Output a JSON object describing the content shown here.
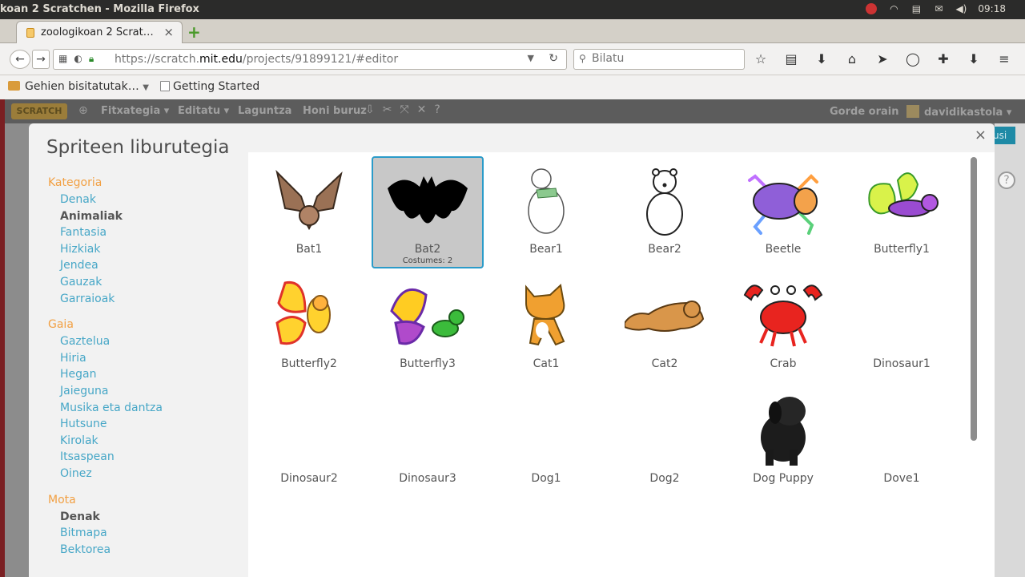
{
  "os": {
    "window_title": "koan 2 Scratchen - Mozilla Firefox",
    "clock": "09:18"
  },
  "browser": {
    "tab_title": "zoologikoan 2 Scrat…",
    "tab_close": "×",
    "new_tab": "+",
    "url_scheme": "https://scratch.",
    "url_host": "mit.edu",
    "url_path": "/projects/91899121/#editor",
    "search_placeholder": "Bilatu",
    "bookmarks": [
      "Gehien bisitatutak…",
      "Getting Started"
    ]
  },
  "scratch": {
    "logo": "SCRATCH",
    "menu": [
      "Fitxategia ▾",
      "Editatu ▾",
      "Laguntza",
      "Honi buruz"
    ],
    "save": "Gorde orain",
    "user": "davidikastola ▾",
    "right_button": "usi"
  },
  "library": {
    "title": "Spriteen liburutegia",
    "close": "×",
    "sections": [
      {
        "heading": "Kategoria",
        "items": [
          {
            "label": "Denak",
            "selected": false
          },
          {
            "label": "Animaliak",
            "selected": true
          },
          {
            "label": "Fantasia",
            "selected": false
          },
          {
            "label": "Hizkiak",
            "selected": false
          },
          {
            "label": "Jendea",
            "selected": false
          },
          {
            "label": "Gauzak",
            "selected": false
          },
          {
            "label": "Garraioak",
            "selected": false
          }
        ]
      },
      {
        "heading": "Gaia",
        "items": [
          {
            "label": "Gaztelua",
            "selected": false
          },
          {
            "label": "Hiria",
            "selected": false
          },
          {
            "label": "Hegan",
            "selected": false
          },
          {
            "label": "Jaieguna",
            "selected": false
          },
          {
            "label": "Musika eta dantza",
            "selected": false
          },
          {
            "label": "Hutsune",
            "selected": false
          },
          {
            "label": "Kirolak",
            "selected": false
          },
          {
            "label": "Itsaspean",
            "selected": false
          },
          {
            "label": "Oinez",
            "selected": false
          }
        ]
      },
      {
        "heading": "Mota",
        "items": [
          {
            "label": "Denak",
            "selected": true
          },
          {
            "label": "Bitmapa",
            "selected": false
          },
          {
            "label": "Bektorea",
            "selected": false
          }
        ]
      }
    ],
    "sprites": [
      {
        "name": "Bat1",
        "icon": "bat1-icon"
      },
      {
        "name": "Bat2",
        "icon": "bat2-icon",
        "selected": true,
        "subtitle": "Costumes: 2"
      },
      {
        "name": "Bear1",
        "icon": "bear1-icon"
      },
      {
        "name": "Bear2",
        "icon": "bear2-icon"
      },
      {
        "name": "Beetle",
        "icon": "beetle-icon"
      },
      {
        "name": "Butterfly1",
        "icon": "butterfly1-icon"
      },
      {
        "name": "Butterfly2",
        "icon": "butterfly2-icon"
      },
      {
        "name": "Butterfly3",
        "icon": "butterfly3-icon"
      },
      {
        "name": "Cat1",
        "icon": "cat1-icon"
      },
      {
        "name": "Cat2",
        "icon": "cat2-icon"
      },
      {
        "name": "Crab",
        "icon": "crab-icon"
      },
      {
        "name": "Dinosaur1",
        "icon": ""
      },
      {
        "name": "Dinosaur2",
        "icon": ""
      },
      {
        "name": "Dinosaur3",
        "icon": ""
      },
      {
        "name": "Dog1",
        "icon": ""
      },
      {
        "name": "Dog2",
        "icon": ""
      },
      {
        "name": "Dog Puppy",
        "icon": "dog-puppy-icon"
      },
      {
        "name": "Dove1",
        "icon": ""
      }
    ]
  }
}
